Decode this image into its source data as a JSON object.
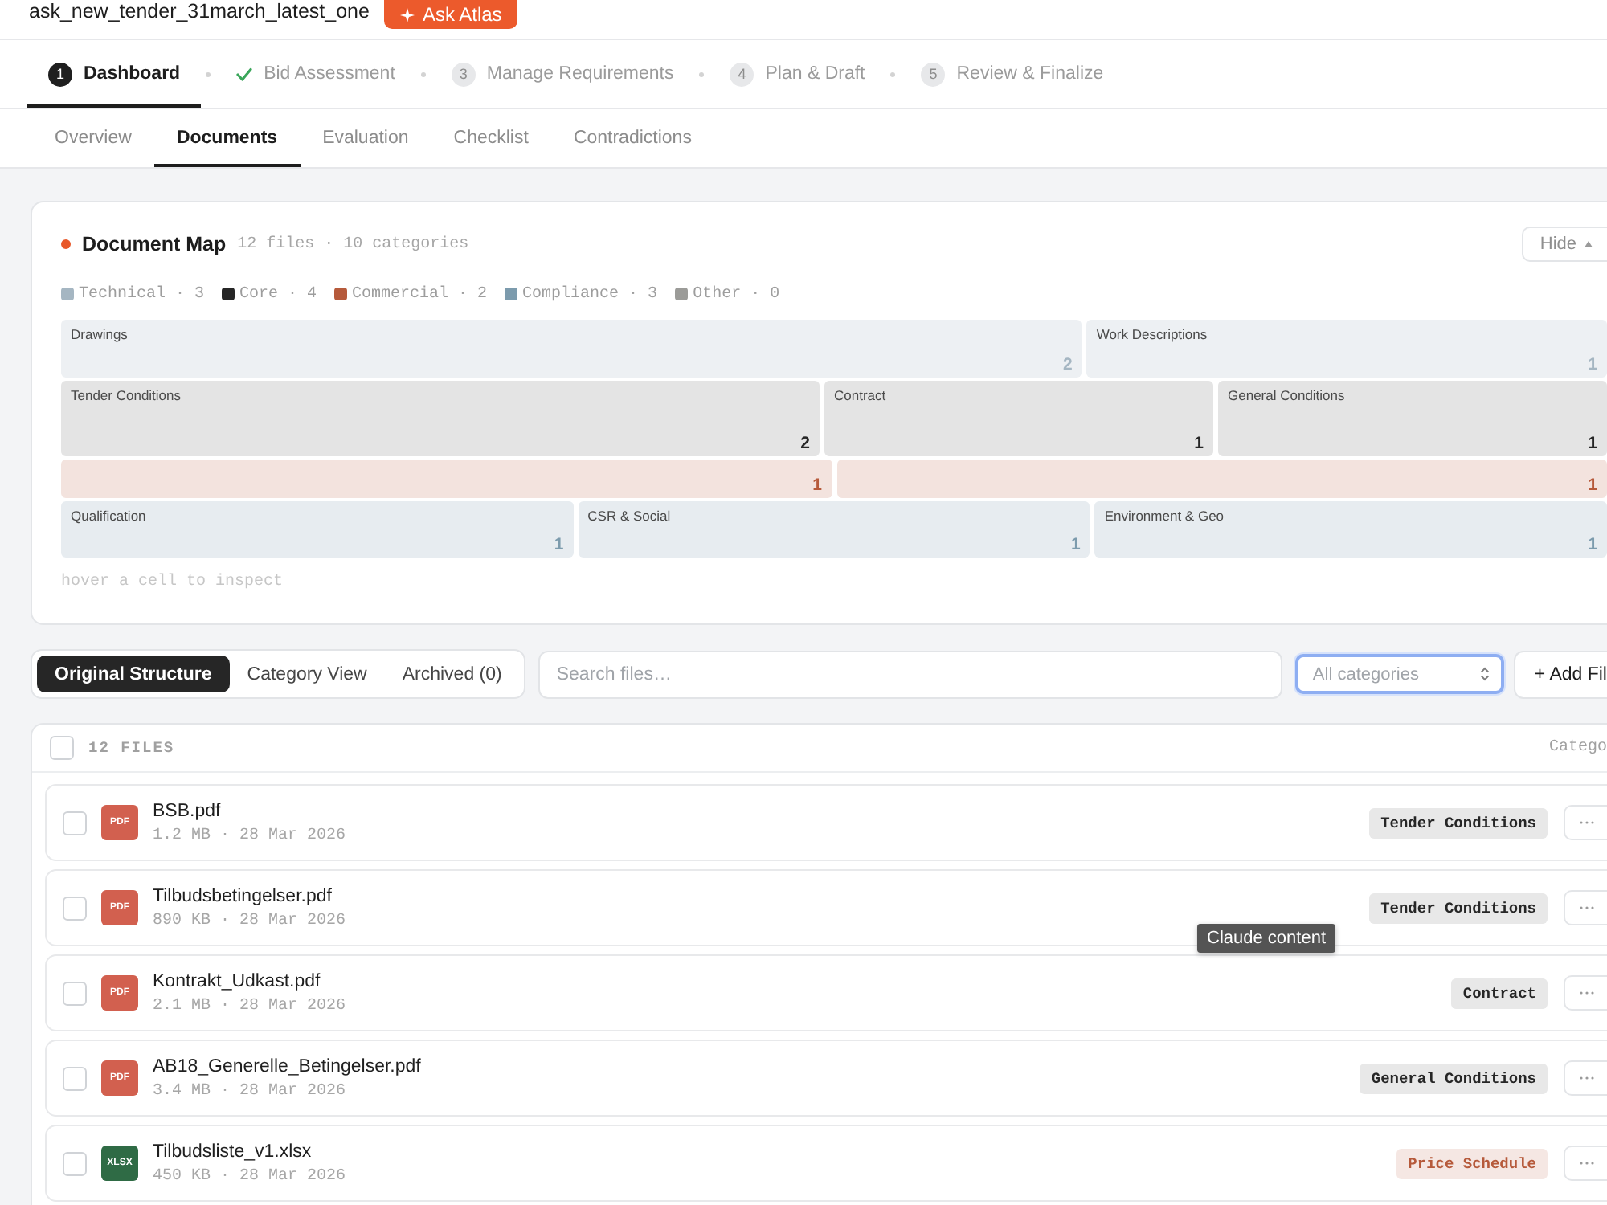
{
  "header": {
    "title": "ask_new_tender_31march_latest_one",
    "ask_button": "Ask Atlas"
  },
  "steps": [
    {
      "number": "1",
      "label": "Dashboard",
      "selected": true,
      "done": false
    },
    {
      "label": "Bid Assessment",
      "selected": false,
      "done": true
    },
    {
      "number": "3",
      "label": "Manage Requirements",
      "selected": false,
      "done": false
    },
    {
      "number": "4",
      "label": "Plan & Draft",
      "selected": false,
      "done": false
    },
    {
      "number": "5",
      "label": "Review & Finalize",
      "selected": false,
      "done": false
    }
  ],
  "tabs": [
    {
      "label": "Overview",
      "selected": false
    },
    {
      "label": "Documents",
      "selected": true
    },
    {
      "label": "Evaluation",
      "selected": false
    },
    {
      "label": "Checklist",
      "selected": false
    },
    {
      "label": "Contradictions",
      "selected": false
    }
  ],
  "document_map": {
    "title": "Document Map",
    "meta": "12 files · 10 categories",
    "hide_button": "Hide",
    "legend": [
      {
        "label": "Technical · 3",
        "color": "#a5b6c2"
      },
      {
        "label": "Core · 4",
        "color": "#262626"
      },
      {
        "label": "Commercial · 2",
        "color": "#b65a3b"
      },
      {
        "label": "Compliance · 3",
        "color": "#7c9bad"
      },
      {
        "label": "Other · 0",
        "color": "#9b9b98"
      }
    ],
    "treemap": [
      {
        "cells": [
          {
            "label": "Drawings",
            "count": "2",
            "color": "#a5b6c2"
          },
          {
            "label": "Work Descriptions",
            "count": "1",
            "color": "#a5b6c2"
          }
        ]
      },
      {
        "cells": [
          {
            "label": "Tender Conditions",
            "count": "2",
            "color": "#262626"
          },
          {
            "label": "Contract",
            "count": "1",
            "color": "#262626"
          },
          {
            "label": "General Conditions",
            "count": "1",
            "color": "#262626"
          }
        ]
      },
      {
        "cells": [
          {
            "count": "1",
            "color": "#b65a3b"
          },
          {
            "count": "1",
            "color": "#b65a3b"
          }
        ]
      },
      {
        "cells": [
          {
            "label": "Qualification",
            "count": "1",
            "color": "#7c9bad"
          },
          {
            "label": "CSR & Social",
            "count": "1",
            "color": "#7c9bad"
          },
          {
            "label": "Environment & Geo",
            "count": "1",
            "color": "#7c9bad"
          }
        ]
      }
    ],
    "hint": "hover a cell to inspect"
  },
  "toolbar": {
    "view_tabs": [
      {
        "label": "Original Structure",
        "selected": true
      },
      {
        "label": "Category View",
        "selected": false
      },
      {
        "label": "Archived (0)",
        "selected": false
      }
    ],
    "search": {
      "placeholder": "Search files…"
    },
    "category_select": {
      "value": "All categories",
      "focused": true
    },
    "add_button": "+ Add Fil"
  },
  "files": {
    "select_all_checked": false,
    "count_label": "12 FILES",
    "column_header": "Catego",
    "tooltip": "Claude content",
    "rows": [
      {
        "name": "BSB.pdf",
        "meta": "1.2 MB · 28 Mar 2026",
        "kind": "pdf",
        "type_label": "PDF",
        "category": "Tender Conditions",
        "color": "#262626",
        "checked": false
      },
      {
        "name": "Tilbudsbetingelser.pdf",
        "meta": "890 KB · 28 Mar 2026",
        "kind": "pdf",
        "type_label": "PDF",
        "category": "Tender Conditions",
        "color": "#262626",
        "checked": false
      },
      {
        "name": "Kontrakt_Udkast.pdf",
        "meta": "2.1 MB · 28 Mar 2026",
        "kind": "pdf",
        "type_label": "PDF",
        "category": "Contract",
        "color": "#262626",
        "checked": false
      },
      {
        "name": "AB18_Generelle_Betingelser.pdf",
        "meta": "3.4 MB · 28 Mar 2026",
        "kind": "pdf",
        "type_label": "PDF",
        "category": "General Conditions",
        "color": "#262626",
        "checked": false
      },
      {
        "name": "Tilbudsliste_v1.xlsx",
        "meta": "450 KB · 28 Mar 2026",
        "kind": "xlsx",
        "type_label": "XLSX",
        "category": "Price Schedule",
        "color": "#b65a3b",
        "checked": false
      }
    ]
  }
}
